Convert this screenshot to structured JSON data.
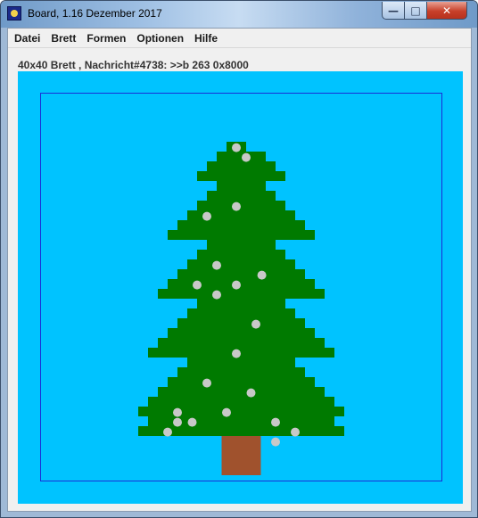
{
  "window": {
    "title": "Board, 1.16 Dezember 2017",
    "min_symbol": "—",
    "max_symbol": "□",
    "close_symbol": "✕"
  },
  "menu": {
    "items": [
      "Datei",
      "Brett",
      "Formen",
      "Optionen",
      "Hilfe"
    ]
  },
  "status": {
    "text": "40x40 Brett , Nachricht#4738: >>b 263 0x8000"
  },
  "board": {
    "grid_size": 40,
    "colors": {
      "background": "#00c3ff",
      "frame": "#1a2fd6",
      "tree": "#007a00",
      "trunk": "#a0522d",
      "ornament": "#c8c8c8"
    }
  }
}
